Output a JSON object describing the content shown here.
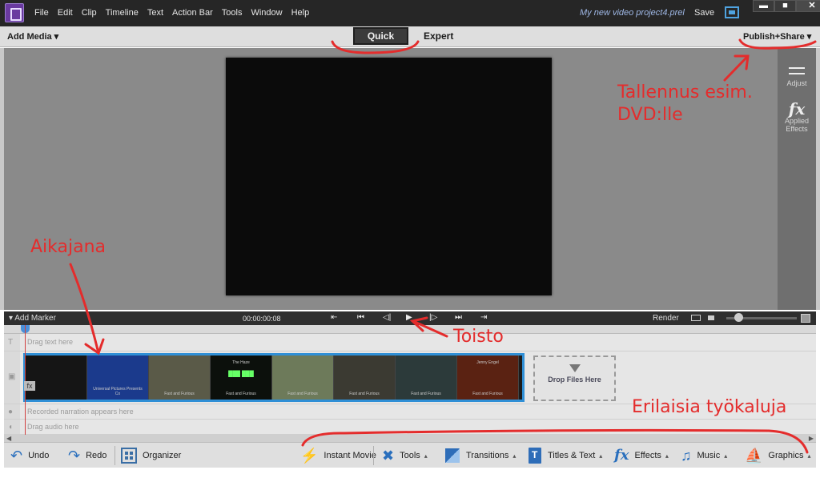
{
  "menu": [
    "File",
    "Edit",
    "Clip",
    "Timeline",
    "Text",
    "Action Bar",
    "Tools",
    "Window",
    "Help"
  ],
  "window": {
    "project_title": "My new video project4.prel",
    "save_label": "Save",
    "minimize": "▬",
    "maximize": "■",
    "close": "✕"
  },
  "toolbar": {
    "add_media": "Add Media ▾",
    "mode_quick": "Quick",
    "mode_expert": "Expert",
    "publish": "Publish+Share ▾"
  },
  "right_panel": {
    "adjust": "Adjust",
    "applied_effects_line1": "Applied",
    "applied_effects_line2": "Effects"
  },
  "transport": {
    "add_marker": "▾  Add Marker",
    "timecode": "00:00:00:08",
    "render": "Render"
  },
  "timeline": {
    "text_hint": "Drag text here",
    "narration_hint": "Recorded narration appears here",
    "audio_hint": "Drag audio here",
    "drop_files": "Drop Files Here",
    "thumbs": [
      {
        "top": "",
        "bottom": "",
        "bg": "#151515"
      },
      {
        "top": "",
        "bottom": "Universal Pictures Presents Co",
        "bg": "#1b3a8c"
      },
      {
        "top": "",
        "bottom": "Fast and Furious",
        "bg": "#5a5a48"
      },
      {
        "top": "The Haze",
        "bottom": "Fast and Furious",
        "bg": "#0c100c",
        "green": "███ ███"
      },
      {
        "top": "",
        "bottom": "Fast and Furious",
        "bg": "#6d7a5a"
      },
      {
        "top": "",
        "bottom": "Fast and Furious",
        "bg": "#3b3a32"
      },
      {
        "top": "",
        "bottom": "Fast and Furious",
        "bg": "#2c3a3a"
      },
      {
        "top": "Jenny Engel",
        "bottom": "Fast and Furious",
        "bg": "#5a2212"
      }
    ]
  },
  "actionbar": {
    "undo": "Undo",
    "redo": "Redo",
    "organizer": "Organizer",
    "instant_movie": "Instant Movie",
    "tools": "Tools",
    "transitions": "Transitions",
    "titles": "Titles & Text",
    "effects": "Effects",
    "music": "Music",
    "graphics": "Graphics",
    "caret": "▴"
  },
  "annotations": {
    "save_dvd_line1": "Tallennus esim.",
    "save_dvd_line2": "DVD:lle",
    "timeline": "Aikajana",
    "play": "Toisto",
    "tools": "Erilaisia työkaluja"
  },
  "colors": {
    "accent": "#2f8fd6",
    "annotation": "#e42c2c"
  }
}
